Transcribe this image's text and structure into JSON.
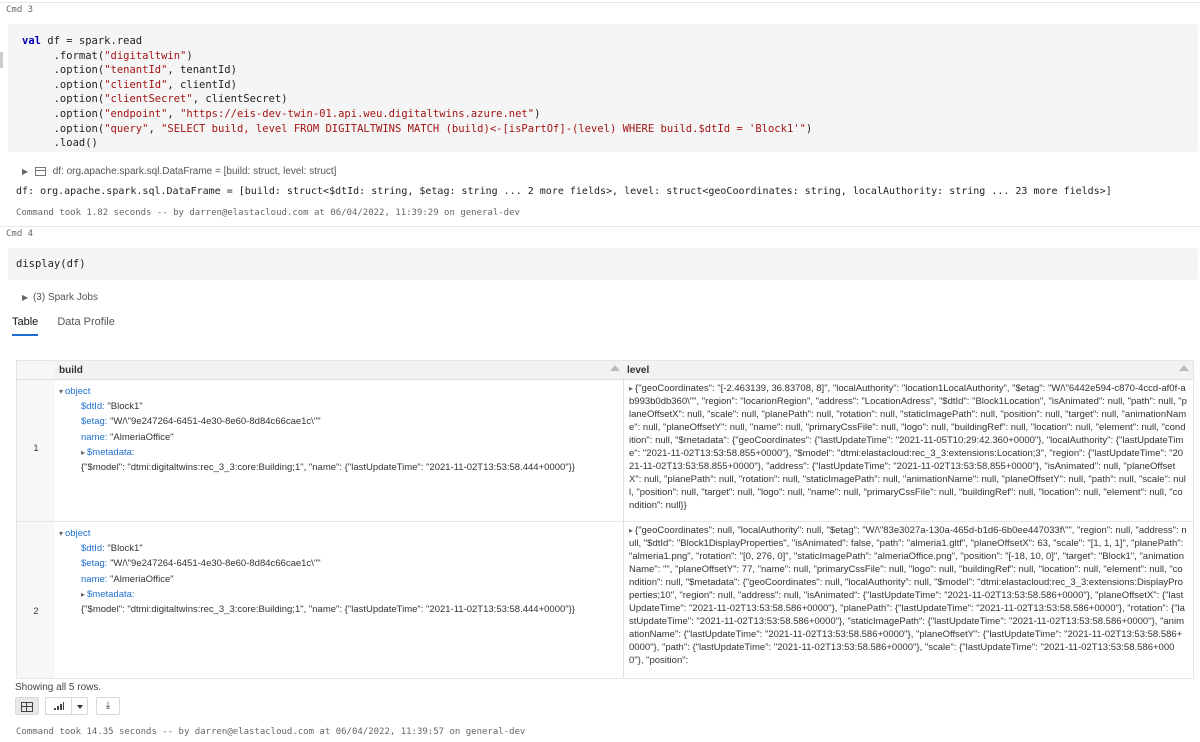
{
  "cmd3": {
    "label": "Cmd 3",
    "code": {
      "line1_kw": "val",
      "line1_rest": " df = spark.read",
      "line2_a": "     .format(",
      "line2_s": "\"digitaltwin\"",
      "line2_b": ")",
      "line3_a": "     .option(",
      "line3_s": "\"tenantId\"",
      "line3_b": ", tenantId)",
      "line4_a": "     .option(",
      "line4_s": "\"clientId\"",
      "line4_b": ", clientId)",
      "line5_a": "     .option(",
      "line5_s": "\"clientSecret\"",
      "line5_b": ", clientSecret)",
      "line6_a": "     .option(",
      "line6_s": "\"endpoint\"",
      "line6_m": ", ",
      "line6_s2": "\"https://eis-dev-twin-01.api.weu.digitaltwins.azure.net\"",
      "line6_b": ")",
      "line7_a": "     .option(",
      "line7_s": "\"query\"",
      "line7_m": ", ",
      "line7_s2": "\"SELECT build, level FROM DIGITALTWINS MATCH (build)<-[isPartOf]-(level) WHERE build.$dtId = 'Block1'\"",
      "line7_b": ")",
      "line8": "     .load()"
    },
    "df_summary": "df:  org.apache.spark.sql.DataFrame = [build: struct, level: struct]",
    "df_schema": "df: org.apache.spark.sql.DataFrame = [build: struct<$dtId: string, $etag: string ... 2 more fields>, level: struct<geoCoordinates: string, localAuthority: string ... 23 more fields>]",
    "footer": "Command took 1.82 seconds -- by darren@elastacloud.com at 06/04/2022, 11:39:29 on general-dev"
  },
  "cmd4": {
    "label": "Cmd 4",
    "code": "display(df)",
    "spark_jobs": "(3) Spark Jobs",
    "tabs": [
      {
        "label": "Table",
        "active": true
      },
      {
        "label": "Data Profile",
        "active": false
      }
    ],
    "columns": [
      "build",
      "level"
    ],
    "rows": [
      {
        "num": "1",
        "build": {
          "object": "object",
          "dtId_key": "$dtId:",
          "dtId_val": "\"Block1\"",
          "etag_key": "$etag:",
          "etag_val": "\"W/\\\"9e247264-6451-4e30-8e60-8d84c66cae1c\\\"\"",
          "name_key": "name:",
          "name_val": "\"AlmeriaOffice\"",
          "metadata_key": "$metadata:",
          "metadata_val": "{\"$model\": \"dtmi:digitaltwins:rec_3_3:core:Building;1\", \"name\": {\"lastUpdateTime\": \"2021-11-02T13:53:58.444+0000\"}}"
        },
        "level": "{\"geoCoordinates\": \"[-2.463139, 36.83708, 8]\", \"localAuthority\": \"location1LocalAuthority\", \"$etag\": \"W/\\\"6442e594-c870-4ccd-af0f-ab993b0db360\\\"\", \"region\": \"locarionRegion\", \"address\": \"LocationAdress\", \"$dtId\": \"Block1Location\", \"isAnimated\": null, \"path\": null, \"planeOffsetX\": null, \"scale\": null, \"planePath\": null, \"rotation\": null, \"staticImagePath\": null, \"position\": null, \"target\": null, \"animationName\": null, \"planeOffsetY\": null, \"name\": null, \"primaryCssFile\": null, \"logo\": null, \"buildingRef\": null, \"location\": null, \"element\": null, \"condition\": null, \"$metadata\": {\"geoCoordinates\": {\"lastUpdateTime\": \"2021-11-05T10:29:42.360+0000\"}, \"localAuthority\": {\"lastUpdateTime\": \"2021-11-02T13:53:58.855+0000\"}, \"$model\": \"dtmi:elastacloud:rec_3_3:extensions:Location;3\", \"region\": {\"lastUpdateTime\": \"2021-11-02T13:53:58.855+0000\"}, \"address\": {\"lastUpdateTime\": \"2021-11-02T13:53:58.855+0000\"}, \"isAnimated\": null, \"planeOffsetX\": null, \"planePath\": null, \"rotation\": null, \"staticImagePath\": null, \"animationName\": null, \"planeOffsetY\": null, \"path\": null, \"scale\": null, \"position\": null, \"target\": null, \"logo\": null, \"name\": null, \"primaryCssFile\": null, \"buildingRef\": null, \"location\": null, \"element\": null, \"condition\": null}}"
      },
      {
        "num": "2",
        "build": {
          "object": "object",
          "dtId_key": "$dtId:",
          "dtId_val": "\"Block1\"",
          "etag_key": "$etag:",
          "etag_val": "\"W/\\\"9e247264-6451-4e30-8e60-8d84c66cae1c\\\"\"",
          "name_key": "name:",
          "name_val": "\"AlmeriaOffice\"",
          "metadata_key": "$metadata:",
          "metadata_val": "{\"$model\": \"dtmi:digitaltwins:rec_3_3:core:Building;1\", \"name\": {\"lastUpdateTime\": \"2021-11-02T13:53:58.444+0000\"}}"
        },
        "level": "{\"geoCoordinates\": null, \"localAuthority\": null, \"$etag\": \"W/\\\"83e3027a-130a-465d-b1d6-6b0ee447033f\\\"\", \"region\": null, \"address\": null, \"$dtId\": \"Block1DisplayProperties\", \"isAnimated\": false, \"path\": \"almeria1.gltf\", \"planeOffsetX\": 63, \"scale\": \"[1, 1, 1]\", \"planePath\": \"almeria1.png\", \"rotation\": \"[0, 276, 0]\", \"staticImagePath\": \"almeriaOffice.png\", \"position\": \"[-18, 10, 0]\", \"target\": \"Block1\", \"animationName\": \"\", \"planeOffsetY\": 77, \"name\": null, \"primaryCssFile\": null, \"logo\": null, \"buildingRef\": null, \"location\": null, \"element\": null, \"condition\": null, \"$metadata\": {\"geoCoordinates\": null, \"localAuthority\": null, \"$model\": \"dtmi:elastacloud:rec_3_3:extensions:DisplayProperties;10\", \"region\": null, \"address\": null, \"isAnimated\": {\"lastUpdateTime\": \"2021-11-02T13:53:58.586+0000\"}, \"planeOffsetX\": {\"lastUpdateTime\": \"2021-11-02T13:53:58.586+0000\"}, \"planePath\": {\"lastUpdateTime\": \"2021-11-02T13:53:58.586+0000\"}, \"rotation\": {\"lastUpdateTime\": \"2021-11-02T13:53:58.586+0000\"}, \"staticImagePath\": {\"lastUpdateTime\": \"2021-11-02T13:53:58.586+0000\"}, \"animationName\": {\"lastUpdateTime\": \"2021-11-02T13:53:58.586+0000\"}, \"planeOffsetY\": {\"lastUpdateTime\": \"2021-11-02T13:53:58.586+0000\"}, \"path\": {\"lastUpdateTime\": \"2021-11-02T13:53:58.586+0000\"}, \"scale\": {\"lastUpdateTime\": \"2021-11-02T13:53:58.586+0000\"}, \"position\":"
      }
    ],
    "showing": "Showing all 5 rows.",
    "footer": "Command took 14.35 seconds -- by darren@elastacloud.com at 06/04/2022, 11:39:57 on general-dev"
  },
  "colors": {
    "keyword": "#0000c0",
    "string": "#a31515",
    "link": "#1f6fd0",
    "code_bg": "#f5f5f5"
  }
}
